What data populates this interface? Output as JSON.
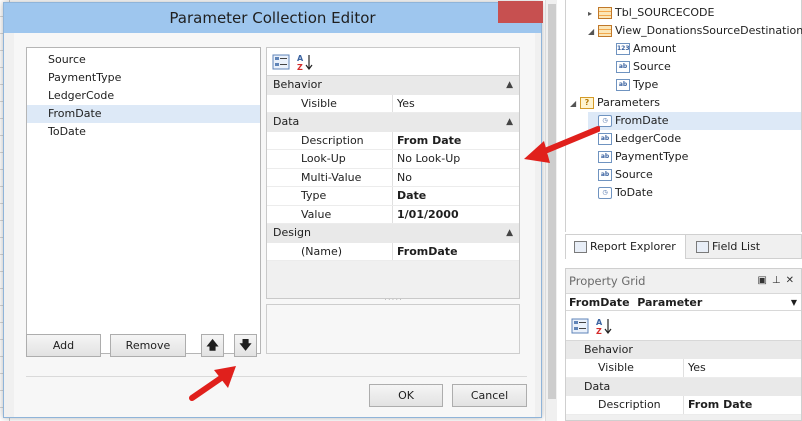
{
  "dialog": {
    "title": "Parameter Collection Editor",
    "parameters": [
      "Source",
      "PaymentType",
      "LedgerCode",
      "FromDate",
      "ToDate"
    ],
    "selected_parameter": "FromDate",
    "buttons": {
      "add": "Add",
      "remove": "Remove",
      "ok": "OK",
      "cancel": "Cancel"
    },
    "property_grid": {
      "categories": [
        {
          "name": "Behavior",
          "rows": [
            {
              "key": "Visible",
              "value": "Yes",
              "bold": false
            }
          ]
        },
        {
          "name": "Data",
          "rows": [
            {
              "key": "Description",
              "value": "From Date",
              "bold": true
            },
            {
              "key": "Look-Up Settings",
              "value": "No Look-Up",
              "bold": false
            },
            {
              "key": "Multi-Value",
              "value": "No",
              "bold": false
            },
            {
              "key": "Type",
              "value": "Date",
              "bold": true
            },
            {
              "key": "Value",
              "value": "1/01/2000",
              "bold": true
            }
          ]
        },
        {
          "name": "Design",
          "rows": [
            {
              "key": "(Name)",
              "value": "FromDate",
              "bold": true
            }
          ]
        }
      ]
    }
  },
  "field_list": {
    "items": [
      {
        "label": "Tbl_SOURCECODE",
        "icon": "table-icon",
        "level": 1,
        "toggle": "▸"
      },
      {
        "label": "View_DonationsSourceDestination",
        "icon": "table-icon",
        "level": 1,
        "toggle": "◢"
      },
      {
        "label": "Amount",
        "icon": "number-field-icon",
        "level": 2,
        "toggle": ""
      },
      {
        "label": "Source",
        "icon": "text-field-icon",
        "level": 2,
        "toggle": ""
      },
      {
        "label": "Type",
        "icon": "text-field-icon",
        "level": 2,
        "toggle": ""
      },
      {
        "label": "Parameters",
        "icon": "parameters-icon",
        "level": 0,
        "toggle": "◢"
      },
      {
        "label": "FromDate",
        "icon": "date-param-icon",
        "level": 1,
        "toggle": "",
        "selected": true
      },
      {
        "label": "LedgerCode",
        "icon": "text-field-icon",
        "level": 1,
        "toggle": ""
      },
      {
        "label": "PaymentType",
        "icon": "text-field-icon",
        "level": 1,
        "toggle": ""
      },
      {
        "label": "Source",
        "icon": "text-field-icon",
        "level": 1,
        "toggle": ""
      },
      {
        "label": "ToDate",
        "icon": "date-param-icon",
        "level": 1,
        "toggle": ""
      }
    ],
    "tabs": [
      "Report Explorer",
      "Field List"
    ]
  },
  "property_panel": {
    "title": "Property Grid",
    "object_name": "FromDate",
    "object_type": "Parameter",
    "categories": [
      {
        "name": "Behavior",
        "rows": [
          {
            "key": "Visible",
            "value": "Yes",
            "bold": false
          }
        ]
      },
      {
        "name": "Data",
        "rows": [
          {
            "key": "Description",
            "value": "From Date",
            "bold": true
          }
        ]
      }
    ]
  },
  "colors": {
    "annotation_arrow": "#e0201c",
    "titlebar": "#9ec6ee",
    "selection": "#dde9f7"
  }
}
